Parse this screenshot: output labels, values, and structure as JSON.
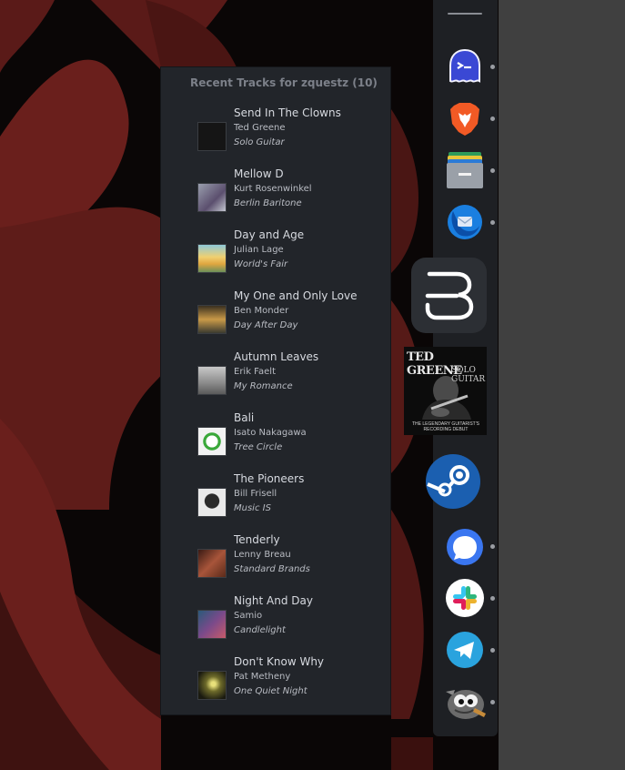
{
  "popup": {
    "header": "Recent Tracks for zquestz (10)",
    "tracks": [
      {
        "title": "Send In The Clowns",
        "artist": "Ted Greene",
        "album": "Solo Guitar",
        "thumb_color": "#151515"
      },
      {
        "title": "Mellow D",
        "artist": "Kurt Rosenwinkel",
        "album": "Berlin Baritone",
        "thumb_color": "#6b6f7a"
      },
      {
        "title": "Day and Age",
        "artist": "Julian Lage",
        "album": "World's Fair",
        "thumb_color": "#d7b44a"
      },
      {
        "title": "My One and Only Love",
        "artist": "Ben Monder",
        "album": "Day After Day",
        "thumb_color": "#8b6a2f"
      },
      {
        "title": "Autumn Leaves",
        "artist": "Erik Faelt",
        "album": "My Romance",
        "thumb_color": "#8f8f8f"
      },
      {
        "title": "Bali",
        "artist": "Isato Nakagawa",
        "album": "Tree Circle",
        "thumb_color": "#f2f2f2"
      },
      {
        "title": "The Pioneers",
        "artist": "Bill Frisell",
        "album": "Music IS",
        "thumb_color": "#e9e9e9"
      },
      {
        "title": "Tenderly",
        "artist": "Lenny Breau",
        "album": "Standard Brands",
        "thumb_color": "#7a3f2a"
      },
      {
        "title": "Night And Day",
        "artist": "Samio",
        "album": "Candlelight",
        "thumb_color": "#5a4a6a"
      },
      {
        "title": "Don't Know Why",
        "artist": "Pat Metheny",
        "album": "One Quiet Night",
        "thumb_color": "#6d6a2a"
      }
    ]
  },
  "dock": {
    "apps": [
      {
        "name": "ghostty-terminal-icon",
        "color": "#3d4ed8"
      },
      {
        "name": "brave-browser-icon",
        "color": "#f25a25"
      },
      {
        "name": "file-manager-icon",
        "color": "#9aa0a8"
      },
      {
        "name": "thunderbird-icon",
        "color": "#1a7fe0"
      },
      {
        "name": "ted-greene-album-icon",
        "color": "#0c0c0c"
      },
      {
        "name": "steam-icon",
        "color": "#1a5fb0"
      },
      {
        "name": "signal-icon",
        "color": "#3a76f0"
      },
      {
        "name": "slack-icon",
        "color": "#ffffff"
      },
      {
        "name": "telegram-icon",
        "color": "#2aa3de"
      },
      {
        "name": "gimp-icon",
        "color": "#6b6b6b"
      }
    ],
    "album_art_text": {
      "line1": "TED GREENE",
      "line2": "SOLO GUITAR",
      "line3": "THE LEGENDARY GUITARIST'S RECORDING DEBUT"
    }
  }
}
